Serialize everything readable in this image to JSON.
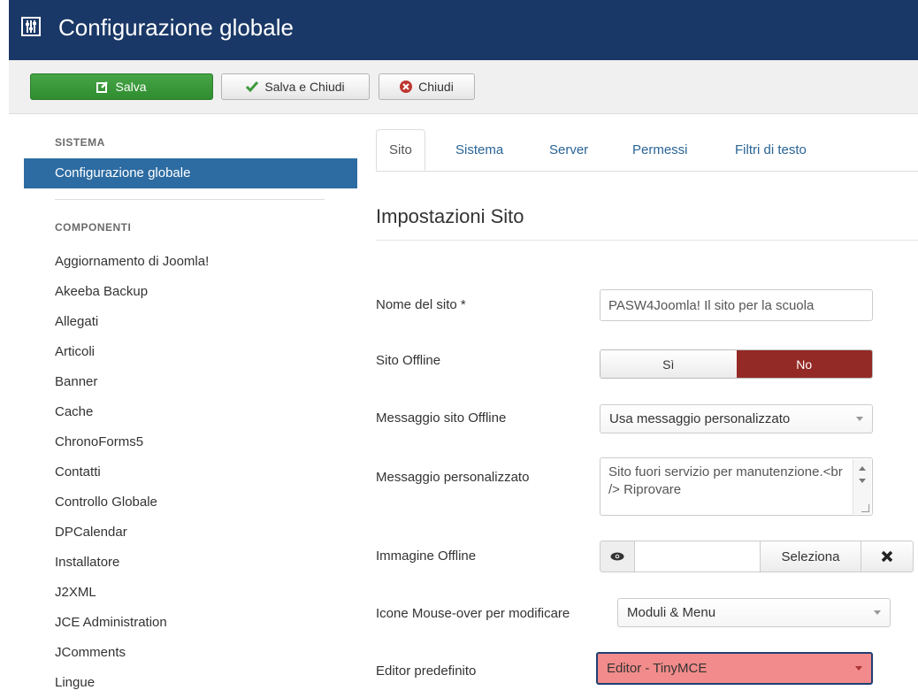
{
  "header": {
    "title": "Configurazione globale",
    "icon": "joomla-config-icon",
    "bg_color": "#1a3867"
  },
  "toolbar": {
    "save_label": "Salva",
    "save_close_label": "Salva e Chiudi",
    "close_label": "Chiudi"
  },
  "sidebar": {
    "sistema_heading": "SISTEMA",
    "active_item": "Configurazione globale",
    "componenti_heading": "COMPONENTI",
    "items": [
      "Aggiornamento di Joomla!",
      "Akeeba Backup",
      "Allegati",
      "Articoli",
      "Banner",
      "Cache",
      "ChronoForms5",
      "Contatti",
      "Controllo Globale",
      "DPCalendar",
      "Installatore",
      "J2XML",
      "JCE Administration",
      "JComments",
      "Lingue"
    ]
  },
  "tabs": [
    "Sito",
    "Sistema",
    "Server",
    "Permessi",
    "Filtri di testo"
  ],
  "active_tab": "Sito",
  "main": {
    "section_title": "Impostazioni Sito",
    "site_name_label": "Nome del sito *",
    "site_name_value": "PASW4Joomla! Il sito per la scuola",
    "offline_label": "Sito Offline",
    "offline_yes": "Sì",
    "offline_no": "No",
    "offline_message_label": "Messaggio sito Offline",
    "offline_message_value": "Usa messaggio personalizzato",
    "custom_message_label": "Messaggio personalizzato",
    "custom_message_value": "Sito fuori servizio per manutenzione.<br /> Riprovare",
    "offline_image_label": "Immagine Offline",
    "offline_image_select": "Seleziona",
    "mouseover_label": "Icone Mouse-over per modificare",
    "mouseover_value": "Moduli & Menu",
    "editor_label": "Editor predefinito",
    "editor_value": "Editor - TinyMCE"
  },
  "colors": {
    "save_green": "#3c9a3c",
    "active_blue": "#2d6ca2",
    "no_red": "#942a25",
    "editor_invalid": "#f28b8b"
  }
}
